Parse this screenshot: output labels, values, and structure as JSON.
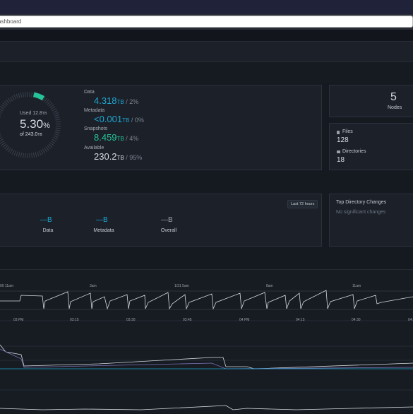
{
  "browser": {
    "url_text": "ashboard"
  },
  "capacity": {
    "used_label": "Used 12.8",
    "used_unit": "TB",
    "percent_value": "5.30",
    "percent_sign": "%",
    "total_label": "of 243.0",
    "total_unit": "TB",
    "fill_fraction": 0.053,
    "accent_color": "#26c39a",
    "track_color": "#3a414b"
  },
  "usage": [
    {
      "label": "Data",
      "value": "4.318",
      "unit": "TB",
      "pct": "2%",
      "color": "#1ea5cf"
    },
    {
      "label": "Metadata",
      "value": "<0.001",
      "unit": "TB",
      "pct": "0%",
      "color": "#1ea5cf"
    },
    {
      "label": "Snapshots",
      "value": "8.459",
      "unit": "TB",
      "pct": "4%",
      "color": "#26c39a"
    },
    {
      "label": "Available",
      "value": "230.2",
      "unit": "TB",
      "pct": "95%",
      "color": "#d8dce2"
    }
  ],
  "nodes": {
    "count": "5",
    "label": "Nodes"
  },
  "files": {
    "label": "Files",
    "count": "128",
    "icon": "file-icon"
  },
  "directories": {
    "label": "Directories",
    "count": "18",
    "icon": "folder-icon"
  },
  "throughput": {
    "range_button": "Last 72 hours",
    "legend": [
      {
        "label": "Data",
        "value": "B",
        "color": "#1ea5cf"
      },
      {
        "label": "Metadata",
        "value": "B",
        "color": "#1ea5cf"
      },
      {
        "label": "Overall",
        "value": "B",
        "color": "#9aa1ab"
      }
    ]
  },
  "top_directory_changes": {
    "title": "Top Directory Changes",
    "empty_text": "No significant changes"
  },
  "timeline_ticks_top": [
    "00 11am",
    "3am",
    "1/31 5am",
    "8am",
    "11am"
  ],
  "timeline_ticks_bottom": [
    "03 PM",
    "03:15",
    "03:30",
    "03:45",
    "04 PM",
    "04:15",
    "04:30",
    "04:45"
  ]
}
